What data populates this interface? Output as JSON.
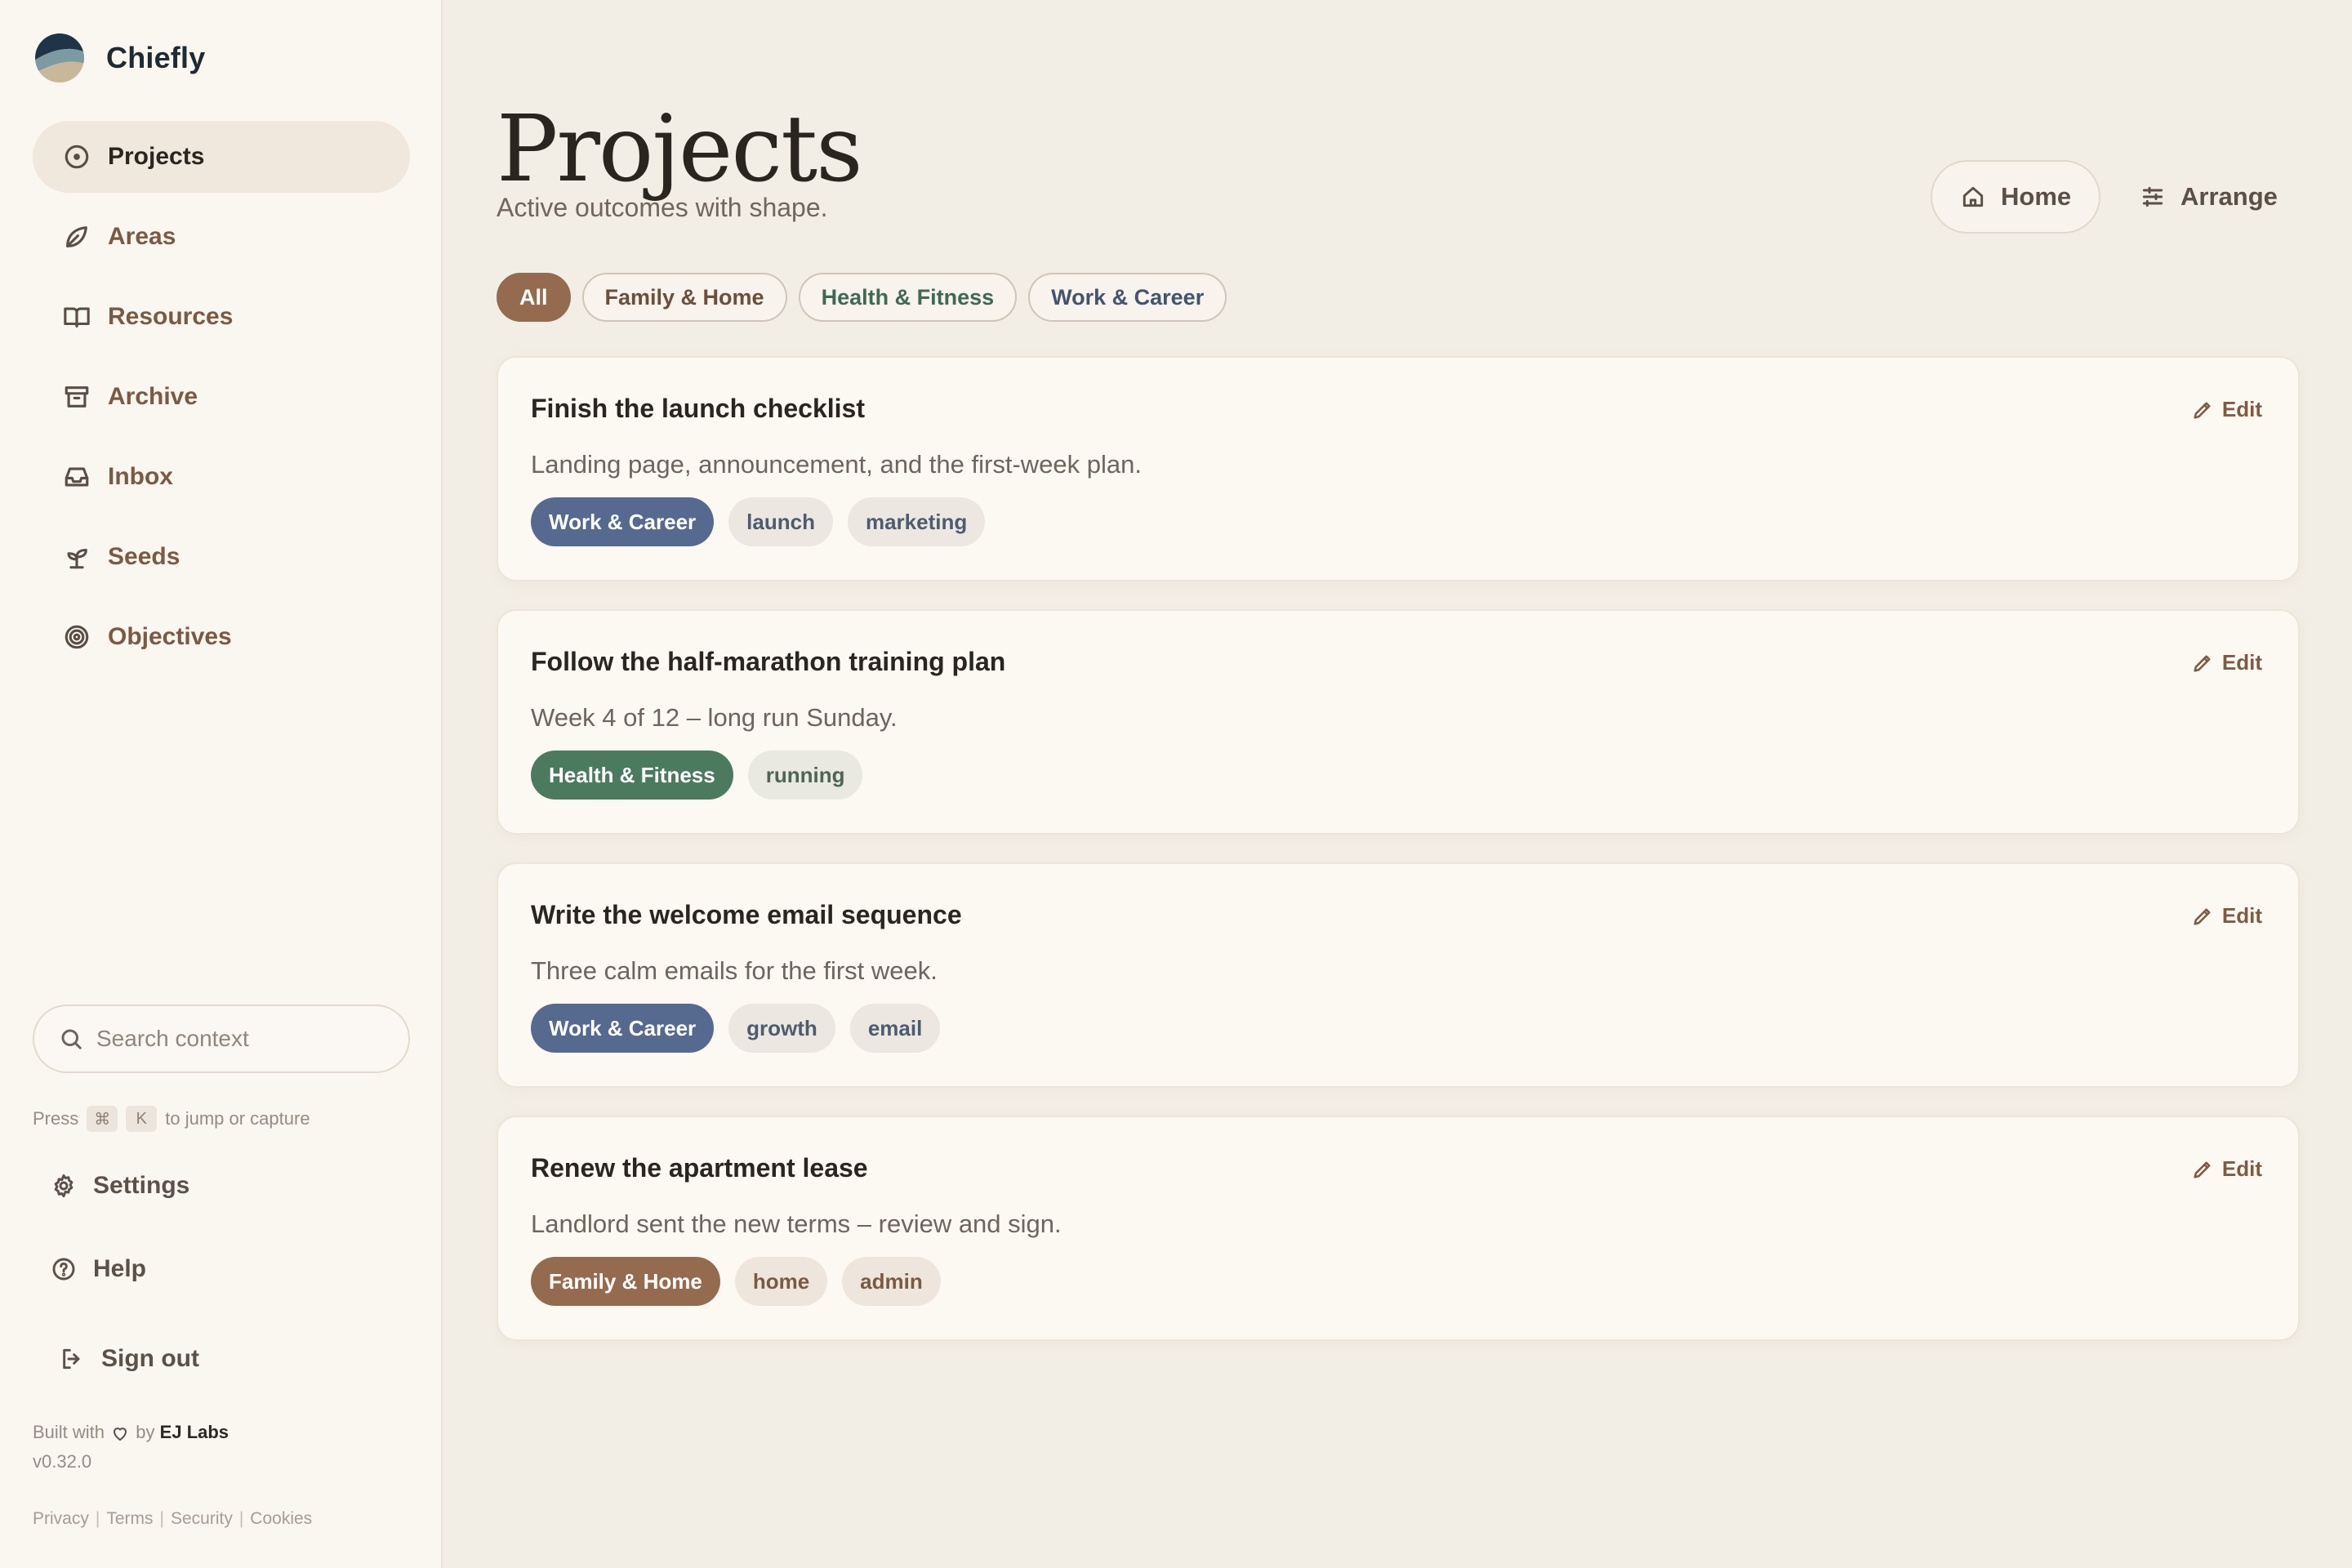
{
  "app": {
    "name": "Chiefly"
  },
  "sidebar": {
    "items": [
      {
        "label": "Projects",
        "icon": "target-circle-icon",
        "active": true
      },
      {
        "label": "Areas",
        "icon": "leaf-icon",
        "active": false
      },
      {
        "label": "Resources",
        "icon": "book-open-icon",
        "active": false
      },
      {
        "label": "Archive",
        "icon": "archive-box-icon",
        "active": false
      },
      {
        "label": "Inbox",
        "icon": "inbox-icon",
        "active": false
      },
      {
        "label": "Seeds",
        "icon": "sprout-icon",
        "active": false
      },
      {
        "label": "Objectives",
        "icon": "bullseye-icon",
        "active": false
      }
    ],
    "search": {
      "placeholder": "Search context"
    },
    "hint": {
      "prefix": "Press",
      "key1": "⌘",
      "key2": "K",
      "suffix": "to jump or capture"
    },
    "bottom": {
      "settings": "Settings",
      "help": "Help",
      "signout": "Sign out"
    },
    "built": {
      "prefix": "Built with",
      "by": "by",
      "company": "EJ Labs",
      "version": "v0.32.0"
    },
    "legal": [
      "Privacy",
      "Terms",
      "Security",
      "Cookies"
    ]
  },
  "header": {
    "title": "Projects",
    "subtitle": "Active outcomes with shape.",
    "home_label": "Home",
    "arrange_label": "Arrange"
  },
  "filters": [
    {
      "label": "All",
      "active": true,
      "color": "#946b4f"
    },
    {
      "label": "Family & Home",
      "active": false,
      "color": "#6b4f3c"
    },
    {
      "label": "Health & Fitness",
      "active": false,
      "color": "#3e6a52"
    },
    {
      "label": "Work & Career",
      "active": false,
      "color": "#44536f"
    }
  ],
  "colors": {
    "work": "#56698f",
    "health": "#4c7a5f",
    "family": "#946b4f",
    "neutral_tag_bg": "#ece8e1",
    "accent": "#946b4f"
  },
  "projects": [
    {
      "title": "Finish the launch checklist",
      "description": "Landing page, announcement, and the first-week plan.",
      "area": {
        "label": "Work & Career",
        "color": "#56698f"
      },
      "tags": [
        "launch",
        "marketing"
      ],
      "edit_label": "Edit"
    },
    {
      "title": "Follow the half-marathon training plan",
      "description": "Week 4 of 12 – long run Sunday.",
      "area": {
        "label": "Health & Fitness",
        "color": "#4c7a5f"
      },
      "tags": [
        "running"
      ],
      "edit_label": "Edit"
    },
    {
      "title": "Write the welcome email sequence",
      "description": "Three calm emails for the first week.",
      "area": {
        "label": "Work & Career",
        "color": "#56698f"
      },
      "tags": [
        "growth",
        "email"
      ],
      "edit_label": "Edit"
    },
    {
      "title": "Renew the apartment lease",
      "description": "Landlord sent the new terms – review and sign.",
      "area": {
        "label": "Family & Home",
        "color": "#946b4f"
      },
      "tags": [
        "home",
        "admin"
      ],
      "edit_label": "Edit"
    }
  ]
}
